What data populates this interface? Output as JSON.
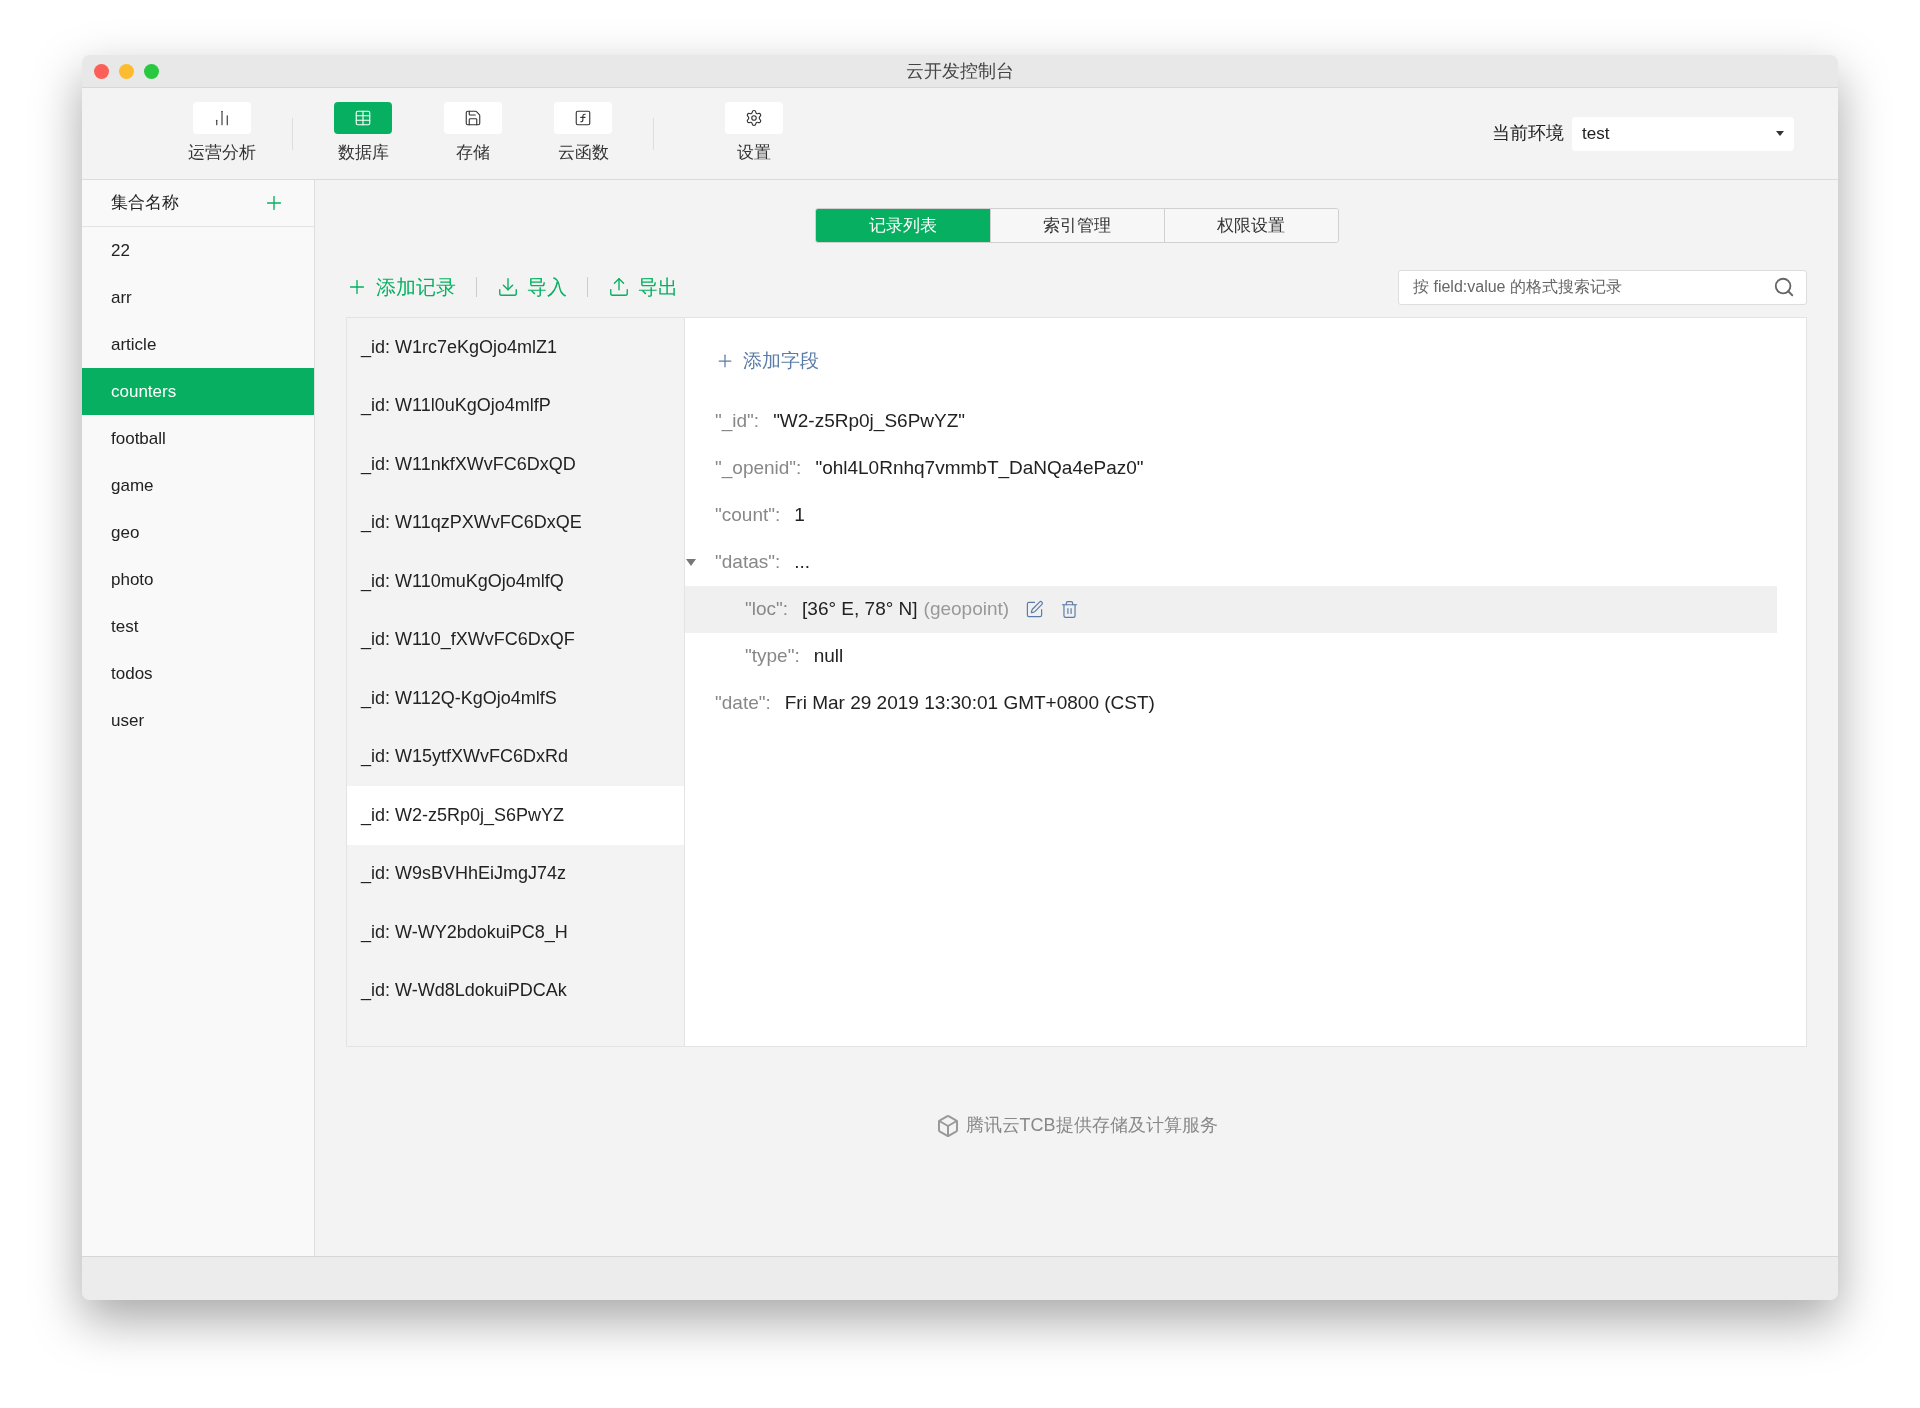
{
  "window": {
    "title": "云开发控制台"
  },
  "toolbar": {
    "items": [
      {
        "kind": "chart",
        "label": "运营分析",
        "selected": false
      },
      {
        "kind": "database",
        "label": "数据库",
        "selected": true
      },
      {
        "kind": "storage",
        "label": "存储",
        "selected": false
      },
      {
        "kind": "function",
        "label": "云函数",
        "selected": false
      },
      {
        "kind": "settings",
        "label": "设置",
        "selected": false
      }
    ],
    "environment": {
      "label": "当前环境",
      "value": "test"
    }
  },
  "sidebar": {
    "title": "集合名称",
    "items": [
      {
        "label": "22",
        "selected": false
      },
      {
        "label": "arr",
        "selected": false
      },
      {
        "label": "article",
        "selected": false
      },
      {
        "label": "counters",
        "selected": true
      },
      {
        "label": "football",
        "selected": false
      },
      {
        "label": "game",
        "selected": false
      },
      {
        "label": "geo",
        "selected": false
      },
      {
        "label": "photo",
        "selected": false
      },
      {
        "label": "test",
        "selected": false
      },
      {
        "label": "todos",
        "selected": false
      },
      {
        "label": "user",
        "selected": false
      }
    ]
  },
  "tabs": [
    {
      "label": "记录列表",
      "selected": true
    },
    {
      "label": "索引管理",
      "selected": false
    },
    {
      "label": "权限设置",
      "selected": false
    }
  ],
  "actions": [
    {
      "kind": "add",
      "label": "添加记录"
    },
    {
      "kind": "import",
      "label": "导入"
    },
    {
      "kind": "export",
      "label": "导出"
    }
  ],
  "search": {
    "placeholder": "按 field:value 的格式搜索记录"
  },
  "records": [
    {
      "label": "_id: W1rc7eKgOjo4mlZ1",
      "selected": false
    },
    {
      "label": "_id: W11l0uKgOjo4mlfP",
      "selected": false
    },
    {
      "label": "_id: W11nkfXWvFC6DxQD",
      "selected": false
    },
    {
      "label": "_id: W11qzPXWvFC6DxQE",
      "selected": false
    },
    {
      "label": "_id: W110muKgOjo4mlfQ",
      "selected": false
    },
    {
      "label": "_id: W110_fXWvFC6DxQF",
      "selected": false
    },
    {
      "label": "_id: W112Q-KgOjo4mlfS",
      "selected": false
    },
    {
      "label": "_id: W15ytfXWvFC6DxRd",
      "selected": false
    },
    {
      "label": "_id: W2-z5Rp0j_S6PwYZ",
      "selected": true
    },
    {
      "label": "_id: W9sBVHhEiJmgJ74z",
      "selected": false
    },
    {
      "label": "_id: W-WY2bdokuiPC8_H",
      "selected": false
    },
    {
      "label": "_id: W-Wd8LdokuiPDCAk",
      "selected": false
    }
  ],
  "detail": {
    "add_field": "添加字段",
    "fields": [
      {
        "key": "\"_id\":",
        "value": "\"W2-z5Rp0j_S6PwYZ\""
      },
      {
        "key": "\"_openid\":",
        "value": "\"ohl4L0Rnhq7vmmbT_DaNQa4ePaz0\""
      },
      {
        "key": "\"count\":",
        "value": "1"
      },
      {
        "key": "\"datas\":",
        "value": "...",
        "expanded": true,
        "children": [
          {
            "key": "\"loc\":",
            "value": "[36° E, 78° N]",
            "type_hint": "(geopoint)",
            "selected": true
          },
          {
            "key": "\"type\":",
            "value": "null",
            "selected": false
          }
        ]
      },
      {
        "key": "\"date\":",
        "value": "Fri Mar 29 2019 13:30:01 GMT+0800 (CST)"
      }
    ]
  },
  "footer": {
    "text": "腾讯云TCB提供存储及计算服务"
  }
}
